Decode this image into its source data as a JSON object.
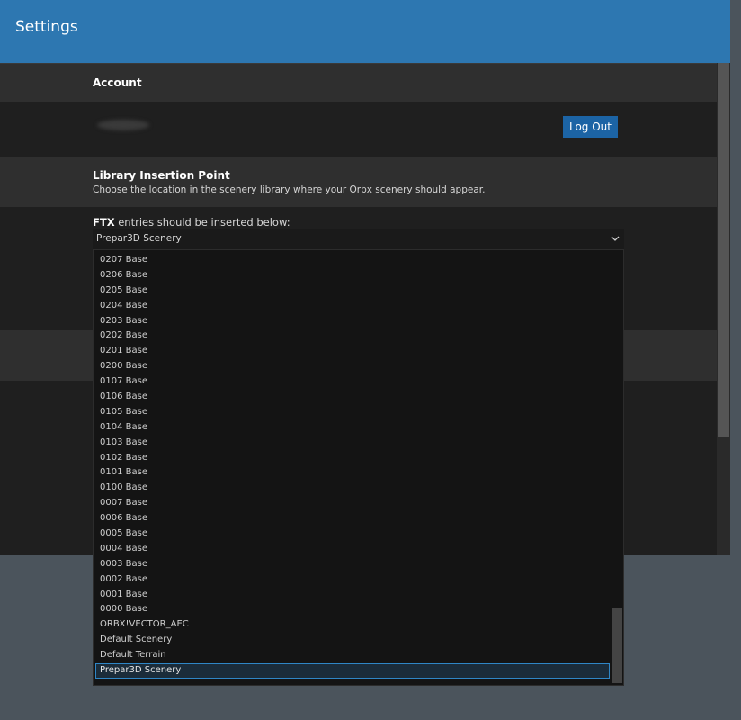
{
  "header": {
    "title": "Settings"
  },
  "account": {
    "section_label": "Account",
    "logout_label": "Log Out"
  },
  "library": {
    "section_label": "Library Insertion Point",
    "description": "Choose the location in the scenery library where your Orbx scenery should appear.",
    "ftx_bold": "FTX",
    "ftx_rest": " entries should be inserted below:",
    "selected_value": "Prepar3D Scenery",
    "options": [
      "0207 Base",
      "0206 Base",
      "0205 Base",
      "0204 Base",
      "0203 Base",
      "0202 Base",
      "0201 Base",
      "0200 Base",
      "0107 Base",
      "0106 Base",
      "0105 Base",
      "0104 Base",
      "0103 Base",
      "0102 Base",
      "0101 Base",
      "0100 Base",
      "0007 Base",
      "0006 Base",
      "0005 Base",
      "0004 Base",
      "0003 Base",
      "0002 Base",
      "0001 Base",
      "0000 Base",
      "ORBX!VECTOR_AEC",
      "Default Scenery",
      "Default Terrain",
      "Prepar3D Scenery"
    ],
    "selected_index": 27
  },
  "icons": {
    "select_chevron": "chevron-down-icon"
  },
  "colors": {
    "header_bg": "#2d77b1",
    "button_bg": "#1c64a5",
    "selected_outline": "#2f86c6"
  }
}
